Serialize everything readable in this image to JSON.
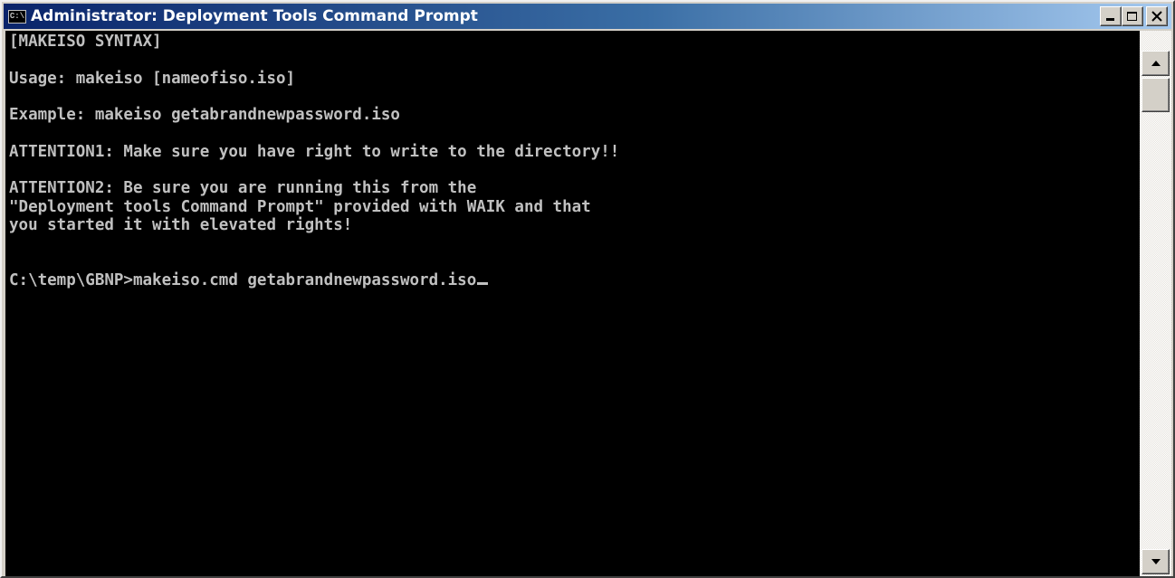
{
  "window": {
    "title": "Administrator: Deployment Tools Command Prompt",
    "icon": "console-icon",
    "icon_glyph": "C:\\",
    "caption_buttons": [
      "minimize",
      "maximize",
      "close"
    ]
  },
  "console": {
    "background": "#000000",
    "text_color": "#c0c0c0",
    "lines": [
      "[MAKEISO SYNTAX]",
      "",
      "Usage: makeiso [nameofiso.iso]",
      "",
      "Example: makeiso getabrandnewpassword.iso",
      "",
      "ATTENTION1: Make sure you have right to write to the directory!!",
      "",
      "ATTENTION2: Be sure you are running this from the",
      "\"Deployment tools Command Prompt\" provided with WAIK and that",
      "you started it with elevated rights!",
      "",
      "",
      "C:\\temp\\GBNP>makeiso.cmd getabrandnewpassword.iso"
    ]
  },
  "scrollbar": {
    "up_icon": "scroll-up-arrow-icon",
    "down_icon": "scroll-down-arrow-icon"
  }
}
